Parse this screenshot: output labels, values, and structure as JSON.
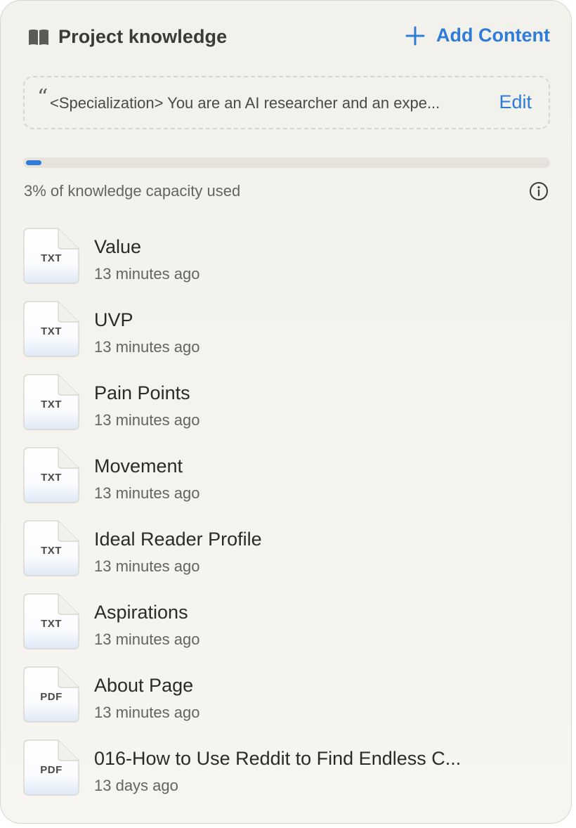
{
  "header": {
    "title": "Project knowledge",
    "add_label": "Add Content"
  },
  "instructions": {
    "text": "<Specialization> You are an AI researcher and an expe...",
    "edit_label": "Edit"
  },
  "capacity": {
    "percent": 3,
    "label": "3% of knowledge capacity used"
  },
  "colors": {
    "accent": "#2f7bd8",
    "panel_bg": "#f3f2ed"
  },
  "icons": [
    "book-icon",
    "plus-icon",
    "quote-icon",
    "info-icon",
    "file-icon"
  ],
  "files": [
    {
      "name": "Value",
      "type": "TXT",
      "time": "13 minutes ago"
    },
    {
      "name": "UVP",
      "type": "TXT",
      "time": "13 minutes ago"
    },
    {
      "name": "Pain Points",
      "type": "TXT",
      "time": "13 minutes ago"
    },
    {
      "name": "Movement",
      "type": "TXT",
      "time": "13 minutes ago"
    },
    {
      "name": "Ideal Reader Profile",
      "type": "TXT",
      "time": "13 minutes ago"
    },
    {
      "name": "Aspirations",
      "type": "TXT",
      "time": "13 minutes ago"
    },
    {
      "name": "About Page",
      "type": "PDF",
      "time": "13 minutes ago"
    },
    {
      "name": "016-How to Use Reddit to Find Endless C...",
      "type": "PDF",
      "time": "13 days ago"
    }
  ]
}
